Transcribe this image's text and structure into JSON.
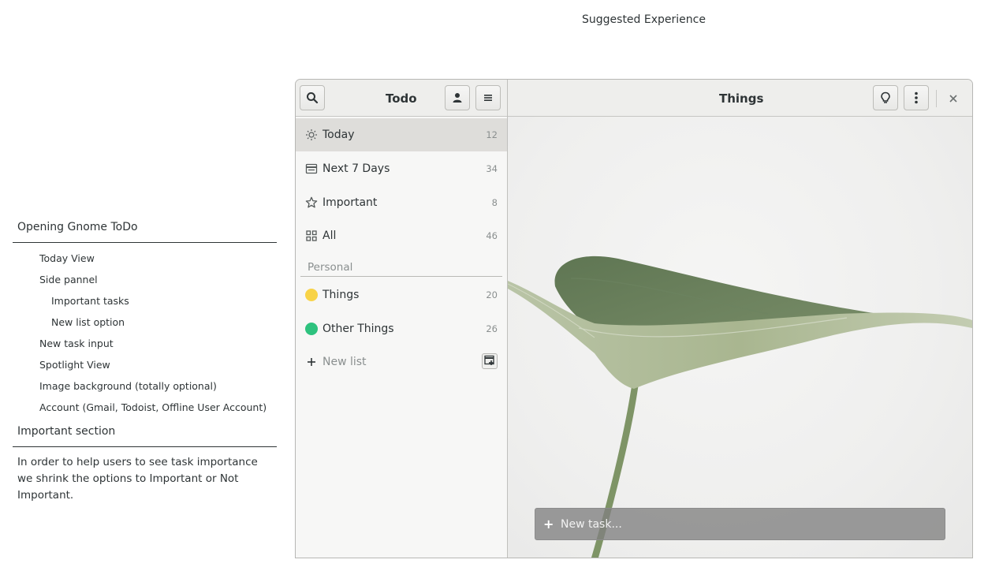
{
  "page_title": "Suggested Experience",
  "notes": {
    "section1_title": "Opening Gnome ToDo",
    "items": [
      "Today View",
      "Side pannel",
      "Important tasks",
      "New list option",
      "New task input",
      "Spotlight View",
      "Image background (totally optional)",
      "Account (Gmail, Todoist, Offline User Account)"
    ],
    "section2_title": "Important section",
    "section2_text": "In order to help users to see task importance we shrink the options to Important or Not Important."
  },
  "window": {
    "sidebar_title": "Todo",
    "content_title": "Things",
    "icons": {
      "search": "search-icon",
      "account": "user-icon",
      "menu": "hamburger-menu-icon",
      "idea": "lightbulb-icon",
      "more": "vertical-dots-icon",
      "close": "close-icon"
    }
  },
  "sidebar": {
    "smart_lists": [
      {
        "label": "Today",
        "count": "12",
        "icon": "sun-icon",
        "selected": true
      },
      {
        "label": "Next 7 Days",
        "count": "34",
        "icon": "calendar-icon"
      },
      {
        "label": "Important",
        "count": "8",
        "icon": "star-icon"
      },
      {
        "label": "All",
        "count": "46",
        "icon": "grid-icon"
      }
    ],
    "section_label": "Personal",
    "lists": [
      {
        "label": "Things",
        "count": "20",
        "color": "#f8d347"
      },
      {
        "label": "Other Things",
        "count": "26",
        "color": "#2ec27e"
      }
    ],
    "new_list_label": "New list"
  },
  "content": {
    "background": "leaf-photo",
    "new_task_placeholder": "New task...",
    "new_task_icon": "plus-icon"
  }
}
